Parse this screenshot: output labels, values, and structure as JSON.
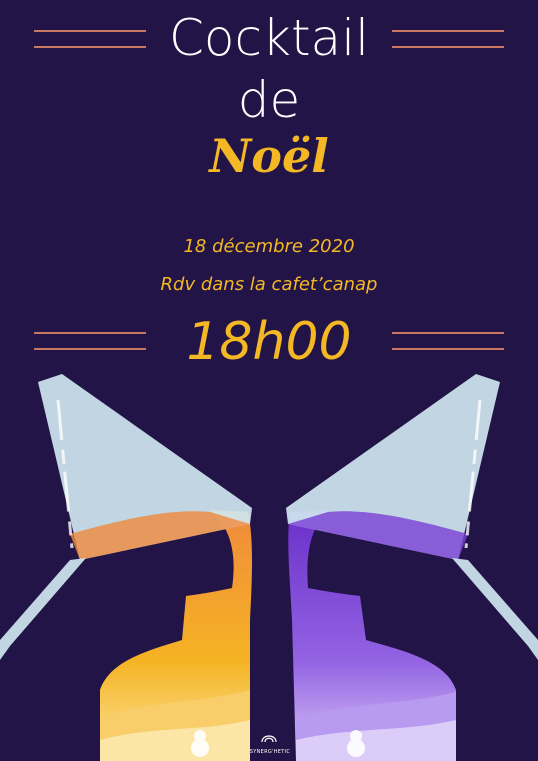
{
  "poster": {
    "title_line1": "Cocktail",
    "title_line2": "de",
    "title_line3": "Noël",
    "date": "18 décembre 2020",
    "location": "Rdv dans la cafet’canap",
    "time": "18h00",
    "logo_text": "SYNERG'HETIC"
  },
  "colors": {
    "background": "#231447",
    "accent": "#f3b824",
    "line": "#c9785f",
    "orange_drink": "#f08a3c",
    "purple_drink": "#7b3fd6"
  }
}
